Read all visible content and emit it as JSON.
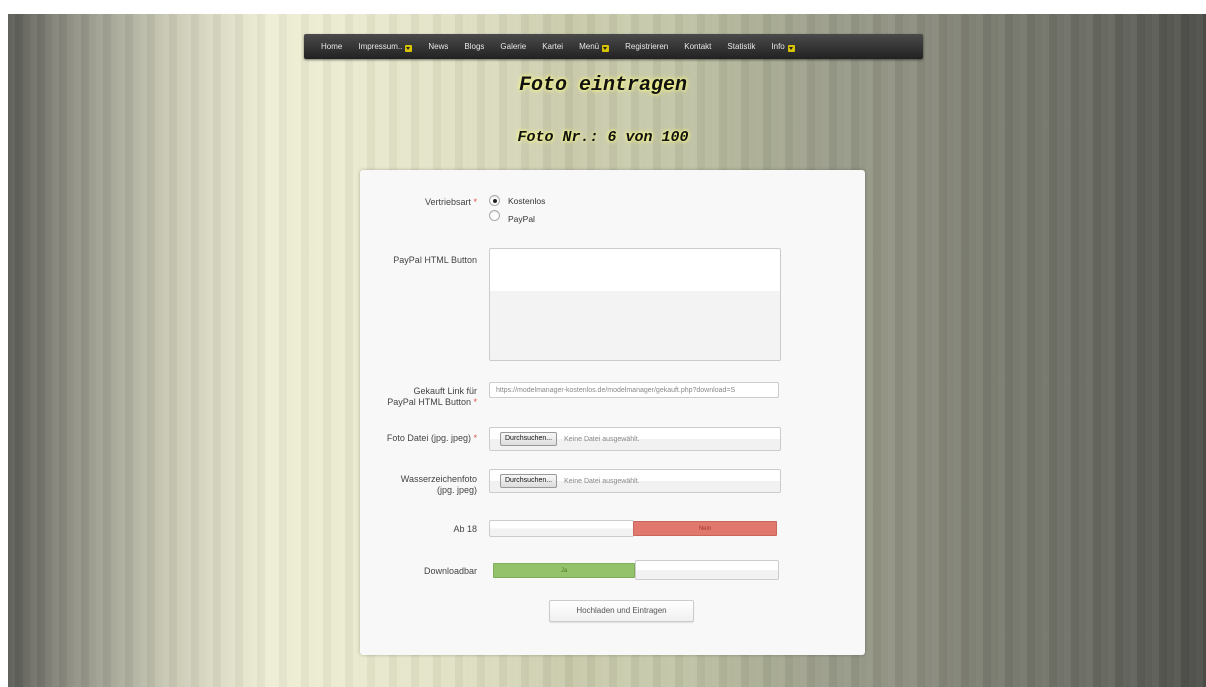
{
  "nav": {
    "items": [
      {
        "label": "Home",
        "dropdown": false
      },
      {
        "label": "Impressum..",
        "dropdown": true
      },
      {
        "label": "News",
        "dropdown": false
      },
      {
        "label": "Blogs",
        "dropdown": false
      },
      {
        "label": "Galerie",
        "dropdown": false
      },
      {
        "label": "Kartei",
        "dropdown": false
      },
      {
        "label": "Menü",
        "dropdown": true
      },
      {
        "label": "Registrieren",
        "dropdown": false
      },
      {
        "label": "Kontakt",
        "dropdown": false
      },
      {
        "label": "Statistik",
        "dropdown": false
      },
      {
        "label": "Info",
        "dropdown": true
      }
    ]
  },
  "header": {
    "title": "Foto eintragen",
    "subtitle": "Foto Nr.: 6 von 100"
  },
  "form": {
    "required_marker": "*",
    "vertriebsart": {
      "label": "Vertriebsart",
      "options": [
        "Kostenlos",
        "PayPal"
      ],
      "selected": "Kostenlos"
    },
    "paypal_button": {
      "label": "PayPal HTML Button",
      "value": ""
    },
    "gekauft_link": {
      "label_line1": "Gekauft Link für",
      "label_line2": "PayPal HTML Button",
      "value": "https://modelmanager-kostenlos.de/modelmanager/gekauft.php?download=S"
    },
    "foto_datei": {
      "label": "Foto Datei (jpg. jpeg)",
      "button_label": "Durchsuchen...",
      "status": "Keine Datei ausgewählt."
    },
    "wasserzeichen": {
      "label_line1": "Wasserzeichenfoto",
      "label_line2": "(jpg. jpeg)",
      "button_label": "Durchsuchen...",
      "status": "Keine Datei ausgewählt."
    },
    "ab18": {
      "label": "Ab 18",
      "state_label": "Nein",
      "value": false
    },
    "downloadbar": {
      "label": "Downloadbar",
      "state_label": "Ja",
      "value": true
    },
    "submit_label": "Hochladen und Eintragen"
  },
  "colors": {
    "switch_off": "#e0786d",
    "switch_on": "#93c26a",
    "required": "#d9534f"
  }
}
